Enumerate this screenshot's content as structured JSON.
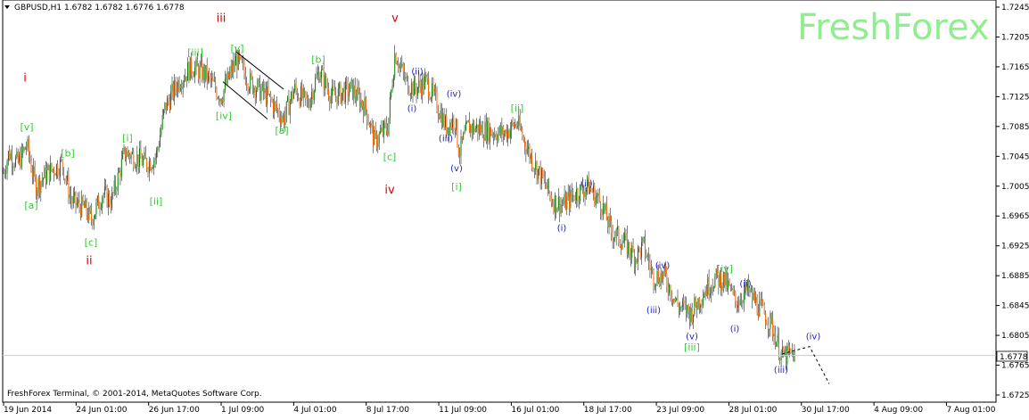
{
  "header": {
    "symbol_line": "GBPUSD,H1  1.6782 1.6782 1.6776 1.6778"
  },
  "brand": {
    "text": "FreshForex",
    "color": "#90ee90"
  },
  "footer": {
    "text": "FreshForex Terminal, © 2001-2014, MetaQuotes Software Corp."
  },
  "price_tag": {
    "text": "1.6778"
  },
  "colors": {
    "bull": "#008000",
    "bear": "#ff6600",
    "wick": "#000000",
    "red_label": "#e00000",
    "green_label": "#33cc33",
    "blue_label": "#2222bb"
  },
  "chart_data": {
    "type": "candlestick",
    "title": "GBPUSD,H1",
    "ylim": [
      1.6725,
      1.7245
    ],
    "x_ticks": [
      "19 Jun 2014",
      "24 Jun 01:00",
      "26 Jun 17:00",
      "1 Jul 09:00",
      "4 Jul 01:00",
      "8 Jul 17:00",
      "11 Jul 09:00",
      "16 Jul 01:00",
      "18 Jul 17:00",
      "23 Jul 09:00",
      "28 Jul 01:00",
      "30 Jul 17:00",
      "4 Aug 09:00",
      "7 Aug 01:00"
    ],
    "y_ticks": [
      "1.7245",
      "1.7205",
      "1.7165",
      "1.7125",
      "1.7085",
      "1.7045",
      "1.7005",
      "1.6965",
      "1.6925",
      "1.6885",
      "1.6845",
      "1.6805",
      "1.6765",
      "1.6725"
    ],
    "last_price": 1.6778,
    "price_path": [
      [
        0,
        1.7005
      ],
      [
        10,
        1.705
      ],
      [
        20,
        1.7035
      ],
      [
        30,
        1.706
      ],
      [
        40,
        1.7005
      ],
      [
        55,
        1.7025
      ],
      [
        70,
        1.7035
      ],
      [
        80,
        1.6985
      ],
      [
        95,
        1.6975
      ],
      [
        102,
        1.696
      ],
      [
        115,
        1.6995
      ],
      [
        125,
        1.6985
      ],
      [
        140,
        1.705
      ],
      [
        150,
        1.7045
      ],
      [
        165,
        1.7035
      ],
      [
        175,
        1.7045
      ],
      [
        185,
        1.711
      ],
      [
        200,
        1.7145
      ],
      [
        215,
        1.7165
      ],
      [
        230,
        1.7155
      ],
      [
        248,
        1.7125
      ],
      [
        265,
        1.7175
      ],
      [
        280,
        1.7145
      ],
      [
        300,
        1.7125
      ],
      [
        318,
        1.7095
      ],
      [
        330,
        1.7135
      ],
      [
        345,
        1.7115
      ],
      [
        358,
        1.716
      ],
      [
        372,
        1.7125
      ],
      [
        395,
        1.7135
      ],
      [
        410,
        1.711
      ],
      [
        420,
        1.7065
      ],
      [
        435,
        1.7085
      ],
      [
        443,
        1.7185
      ],
      [
        455,
        1.7145
      ],
      [
        465,
        1.7135
      ],
      [
        478,
        1.7145
      ],
      [
        490,
        1.7115
      ],
      [
        500,
        1.7085
      ],
      [
        510,
        1.7095
      ],
      [
        515,
        1.705
      ],
      [
        525,
        1.7085
      ],
      [
        545,
        1.708
      ],
      [
        565,
        1.7075
      ],
      [
        580,
        1.709
      ],
      [
        595,
        1.7045
      ],
      [
        610,
        1.701
      ],
      [
        620,
        1.6985
      ],
      [
        632,
        1.698
      ],
      [
        645,
        1.6995
      ],
      [
        660,
        1.7005
      ],
      [
        675,
        1.698
      ],
      [
        685,
        1.6945
      ],
      [
        700,
        1.693
      ],
      [
        712,
        1.691
      ],
      [
        722,
        1.6925
      ],
      [
        732,
        1.6885
      ],
      [
        745,
        1.6885
      ],
      [
        760,
        1.6845
      ],
      [
        775,
        1.6835
      ],
      [
        790,
        1.6865
      ],
      [
        800,
        1.688
      ],
      [
        812,
        1.688
      ],
      [
        825,
        1.685
      ],
      [
        838,
        1.6865
      ],
      [
        850,
        1.6845
      ],
      [
        865,
        1.682
      ],
      [
        877,
        1.6775
      ],
      [
        890,
        1.678
      ]
    ],
    "labels": [
      {
        "text": "i",
        "x": 28,
        "y": 1.7145,
        "color": "red"
      },
      {
        "text": "ii",
        "x": 100,
        "y": 1.69,
        "color": "red"
      },
      {
        "text": "iii",
        "x": 248,
        "y": 1.7225,
        "color": "red"
      },
      {
        "text": "iv",
        "x": 437,
        "y": 1.6995,
        "color": "red"
      },
      {
        "text": "v",
        "x": 443,
        "y": 1.7225,
        "color": "red"
      },
      {
        "text": "[v]",
        "x": 30,
        "y": 1.708,
        "color": "green"
      },
      {
        "text": "[a]",
        "x": 35,
        "y": 1.6975,
        "color": "green"
      },
      {
        "text": "[b]",
        "x": 76,
        "y": 1.7045,
        "color": "green"
      },
      {
        "text": "[c]",
        "x": 102,
        "y": 1.6925,
        "color": "green"
      },
      {
        "text": "[i]",
        "x": 143,
        "y": 1.7065,
        "color": "green"
      },
      {
        "text": "[ii]",
        "x": 175,
        "y": 1.698,
        "color": "green"
      },
      {
        "text": "[iii]",
        "x": 219,
        "y": 1.718,
        "color": "green"
      },
      {
        "text": "[iv]",
        "x": 251,
        "y": 1.7095,
        "color": "green"
      },
      {
        "text": "[v]",
        "x": 266,
        "y": 1.7185,
        "color": "green"
      },
      {
        "text": "[a]",
        "x": 316,
        "y": 1.7075,
        "color": "green"
      },
      {
        "text": "[b]",
        "x": 357,
        "y": 1.717,
        "color": "green"
      },
      {
        "text": "[c]",
        "x": 437,
        "y": 1.704,
        "color": "green"
      },
      {
        "text": "[i]",
        "x": 512,
        "y": 1.7,
        "color": "green"
      },
      {
        "text": "[ii]",
        "x": 580,
        "y": 1.7105,
        "color": "green"
      },
      {
        "text": "[iv]",
        "x": 813,
        "y": 1.689,
        "color": "green"
      },
      {
        "text": "[iii]",
        "x": 776,
        "y": 1.6785,
        "color": "green"
      },
      {
        "text": "(ii)",
        "x": 468,
        "y": 1.7155,
        "color": "blue"
      },
      {
        "text": "(i)",
        "x": 462,
        "y": 1.7105,
        "color": "blue"
      },
      {
        "text": "(iv)",
        "x": 509,
        "y": 1.7125,
        "color": "blue"
      },
      {
        "text": "(iii)",
        "x": 500,
        "y": 1.7065,
        "color": "blue"
      },
      {
        "text": "(v)",
        "x": 512,
        "y": 1.7025,
        "color": "blue"
      },
      {
        "text": "(ii)",
        "x": 658,
        "y": 1.7005,
        "color": "blue"
      },
      {
        "text": "(i)",
        "x": 630,
        "y": 1.6945,
        "color": "blue"
      },
      {
        "text": "(iv)",
        "x": 743,
        "y": 1.6895,
        "color": "blue"
      },
      {
        "text": "(iii)",
        "x": 733,
        "y": 1.6835,
        "color": "blue"
      },
      {
        "text": "(v)",
        "x": 776,
        "y": 1.68,
        "color": "blue"
      },
      {
        "text": "(ii)",
        "x": 836,
        "y": 1.687,
        "color": "blue"
      },
      {
        "text": "(i)",
        "x": 824,
        "y": 1.681,
        "color": "blue"
      },
      {
        "text": "(iv)",
        "x": 912,
        "y": 1.68,
        "color": "blue"
      },
      {
        "text": "(iii)",
        "x": 876,
        "y": 1.6755,
        "color": "blue"
      }
    ],
    "channel": [
      [
        265,
        1.7185
      ],
      [
        318,
        1.7135
      ],
      [
        300,
        1.7095
      ],
      [
        250,
        1.7145
      ]
    ],
    "projection": [
      [
        877,
        1.678
      ],
      [
        908,
        1.679
      ],
      [
        930,
        1.674
      ]
    ]
  }
}
